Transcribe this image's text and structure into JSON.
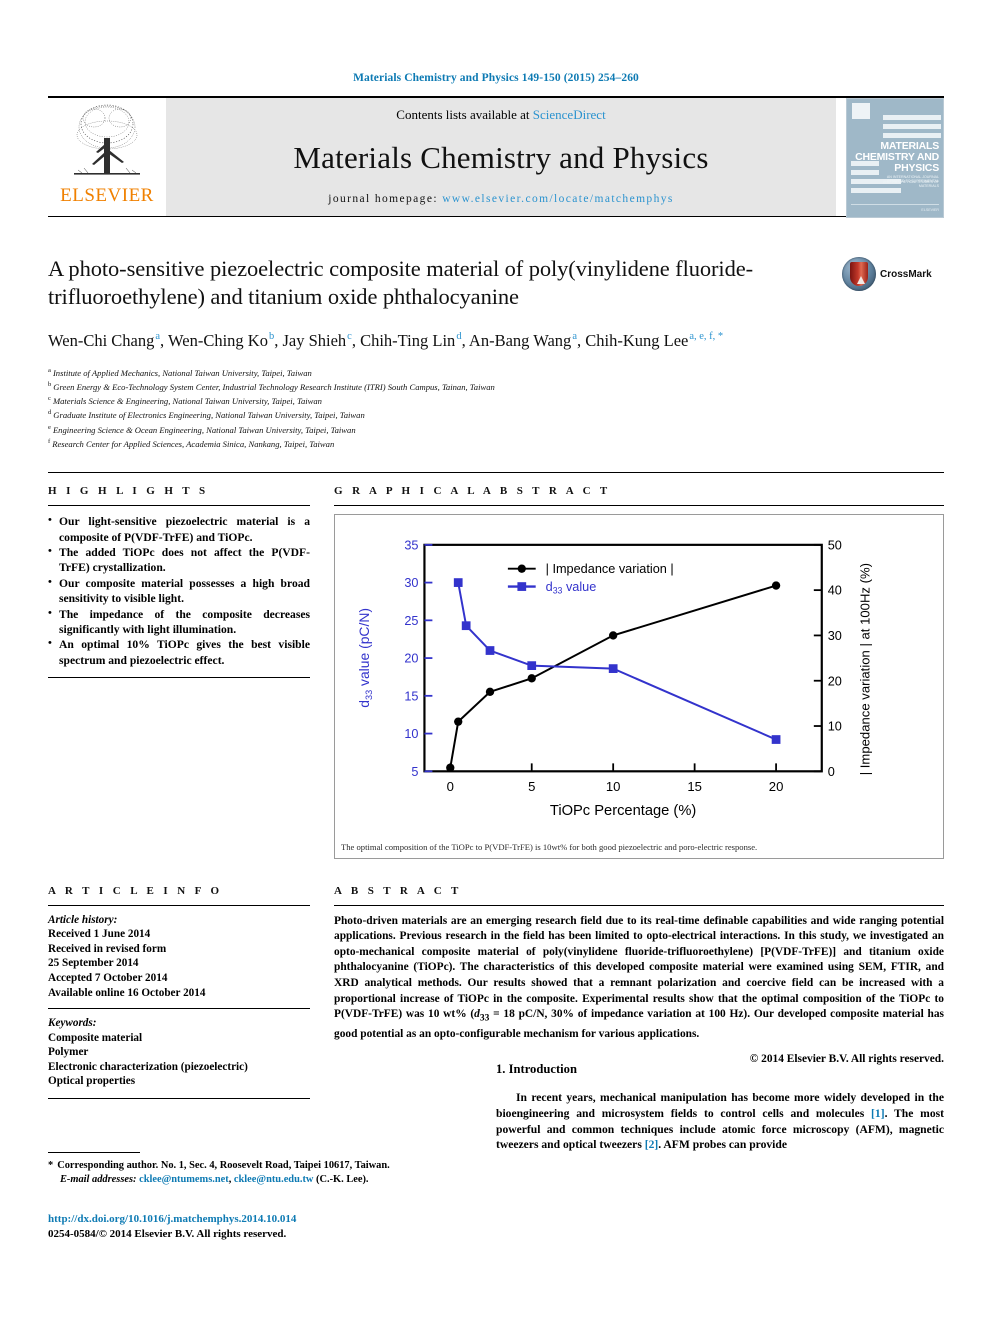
{
  "running_head": "Materials Chemistry and Physics 149-150 (2015) 254–260",
  "masthead": {
    "contents_prefix": "Contents lists available at ",
    "sciencedirect": "ScienceDirect",
    "journal_name": "Materials Chemistry and Physics",
    "homepage_prefix": "journal homepage: ",
    "homepage_url": "www.elsevier.com/locate/matchemphys",
    "publisher": "ELSEVIER",
    "cover": {
      "title_line1": "MATERIALS",
      "title_line2": "CHEMISTRY AND",
      "title_line3": "PHYSICS",
      "sub_line1": "AN INTERNATIONAL JOURNAL DEVOTED TO EXPERIMENTAL",
      "sub_line2": "AND THEORETICAL STUDIES OF MATERIALS",
      "footer": "ELSEVIER"
    }
  },
  "article": {
    "title": "A photo-sensitive piezoelectric composite material of poly(vinylidene fluoride-trifluoroethylene) and titanium oxide phthalocyanine",
    "crossmark_label": "CrossMark",
    "authors": [
      {
        "name": "Wen-Chi Chang",
        "marks": "a",
        "sep": ", "
      },
      {
        "name": "Wen-Ching Ko",
        "marks": "b",
        "sep": ", "
      },
      {
        "name": "Jay Shieh",
        "marks": "c",
        "sep": ", "
      },
      {
        "name": "Chih-Ting Lin",
        "marks": "d",
        "sep": ", "
      },
      {
        "name": "An-Bang Wang",
        "marks": "a",
        "sep": ", "
      },
      {
        "name": "Chih-Kung Lee",
        "marks": "a, e, f, *",
        "sep": ""
      }
    ],
    "affiliations": [
      {
        "mark": "a",
        "text": "Institute of Applied Mechanics, National Taiwan University, Taipei, Taiwan"
      },
      {
        "mark": "b",
        "text": "Green Energy & Eco-Technology System Center, Industrial Technology Research Institute (ITRI) South Campus, Tainan, Taiwan"
      },
      {
        "mark": "c",
        "text": "Materials Science & Engineering, National Taiwan University, Taipei, Taiwan"
      },
      {
        "mark": "d",
        "text": "Graduate Institute of Electronics Engineering, National Taiwan University, Taipei, Taiwan"
      },
      {
        "mark": "e",
        "text": "Engineering Science & Ocean Engineering, National Taiwan University, Taipei, Taiwan"
      },
      {
        "mark": "f",
        "text": "Research Center for Applied Sciences, Academia Sinica, Nankang, Taipei, Taiwan"
      }
    ]
  },
  "highlights": {
    "heading": "H I G H L I G H T S",
    "items": [
      "Our light-sensitive piezoelectric material is a composite of P(VDF-TrFE) and TiOPc.",
      "The added TiOPc does not affect the P(VDF-TrFE) crystallization.",
      "Our composite material possesses a high broad sensitivity to visible light.",
      "The impedance of the composite decreases significantly with light illumination.",
      "An optimal 10% TiOPc gives the best visible spectrum and piezoelectric effect."
    ]
  },
  "graphical_abstract": {
    "heading": "G R A P H I C A L   A B S T R A C T",
    "caption": "The optimal composition of the TiOPc to P(VDF-TrFE) is 10wt% for both good piezoelectric and poro-electric response."
  },
  "chart_data": {
    "type": "line",
    "title": "",
    "xlabel": "TiOPc Percentage (%)",
    "ylabel": "d33 value (pC/N)",
    "y2label": "| Impedance variation | at 100Hz (%)",
    "xlim": [
      -1.5,
      23
    ],
    "ylim": [
      5,
      35
    ],
    "y2lim": [
      0,
      50
    ],
    "xticks": [
      0,
      5,
      10,
      15,
      20
    ],
    "yticks": [
      5,
      10,
      15,
      20,
      25,
      30,
      35
    ],
    "y2ticks": [
      0,
      10,
      20,
      30,
      40,
      50
    ],
    "grid": false,
    "legend_position": "top-center",
    "series": [
      {
        "name": "| Impedance variation |",
        "axis": "right",
        "color": "#000000",
        "marker": "circle",
        "x": [
          0,
          0.5,
          2.5,
          5,
          10,
          20
        ],
        "y": [
          0.8,
          11.0,
          17.5,
          20.5,
          30.0,
          41.0
        ]
      },
      {
        "name": "d33 value",
        "axis": "left",
        "color": "#3333cc",
        "marker": "square",
        "x": [
          0.5,
          1.0,
          2.5,
          5,
          10,
          20
        ],
        "y": [
          30.0,
          24.3,
          21.0,
          19.0,
          18.6,
          9.2
        ]
      }
    ]
  },
  "article_info": {
    "heading": "A R T I C L E   I N F O",
    "history_label": "Article history:",
    "history": [
      "Received 1 June 2014",
      "Received in revised form",
      "25 September 2014",
      "Accepted 7 October 2014",
      "Available online 16 October 2014"
    ],
    "keywords_label": "Keywords:",
    "keywords": [
      "Composite material",
      "Polymer",
      "Electronic characterization (piezoelectric)",
      "Optical properties"
    ]
  },
  "abstract": {
    "heading": "A B S T R A C T",
    "text": "Photo-driven materials are an emerging research field due to its real-time definable capabilities and wide ranging potential applications. Previous research in the field has been limited to opto-electrical interactions. In this study, we investigated an opto-mechanical composite material of poly(vinylidene fluoride-trifluoroethylene) [P(VDF-TrFE)] and titanium oxide phthalocyanine (TiOPc). The characteristics of this developed composite material were examined using SEM, FTIR, and XRD analytical methods. Our results showed that a remnant polarization and coercive field can be increased with a proportional increase of TiOPc in the composite. Experimental results show that the optimal composition of the TiOPc to P(VDF-TrFE) was 10 wt% (",
    "text_italic_d": "d",
    "text_sub_33": "33",
    "text_mid": " = 18 pC/N, 30% of impedance variation at 100 Hz). Our developed composite material has good potential as an opto-configurable mechanism for various applications.",
    "copyright": "© 2014 Elsevier B.V. All rights reserved."
  },
  "introduction": {
    "heading": "1.  Introduction",
    "para_1": "In recent years, mechanical manipulation has become more widely developed in the bioengineering and microsystem fields to control cells and molecules ",
    "ref_1": "[1]",
    "para_2": ". The most powerful and common techniques include atomic force microscopy (AFM), magnetic tweezers and optical tweezers ",
    "ref_2": "[2]",
    "para_3": ". AFM probes can provide"
  },
  "footnote": {
    "star": "*",
    "corresponding": "Corresponding author. No. 1, Sec. 4, Roosevelt Road, Taipei 10617, Taiwan.",
    "email_label": "E-mail addresses:",
    "email_1": "cklee@ntumems.net",
    "email_sep": ", ",
    "email_2": "cklee@ntu.edu.tw",
    "email_suffix": " (C.-K. Lee)."
  },
  "doi_block": {
    "doi": "http://dx.doi.org/10.1016/j.matchemphys.2014.10.014",
    "issn_line": "0254-0584/© 2014 Elsevier B.V. All rights reserved."
  },
  "colors": {
    "link": "#0d7ab3",
    "sciencedirect": "#2b93cf",
    "elsevier_orange": "#f08000",
    "series_blue": "#3333cc"
  }
}
